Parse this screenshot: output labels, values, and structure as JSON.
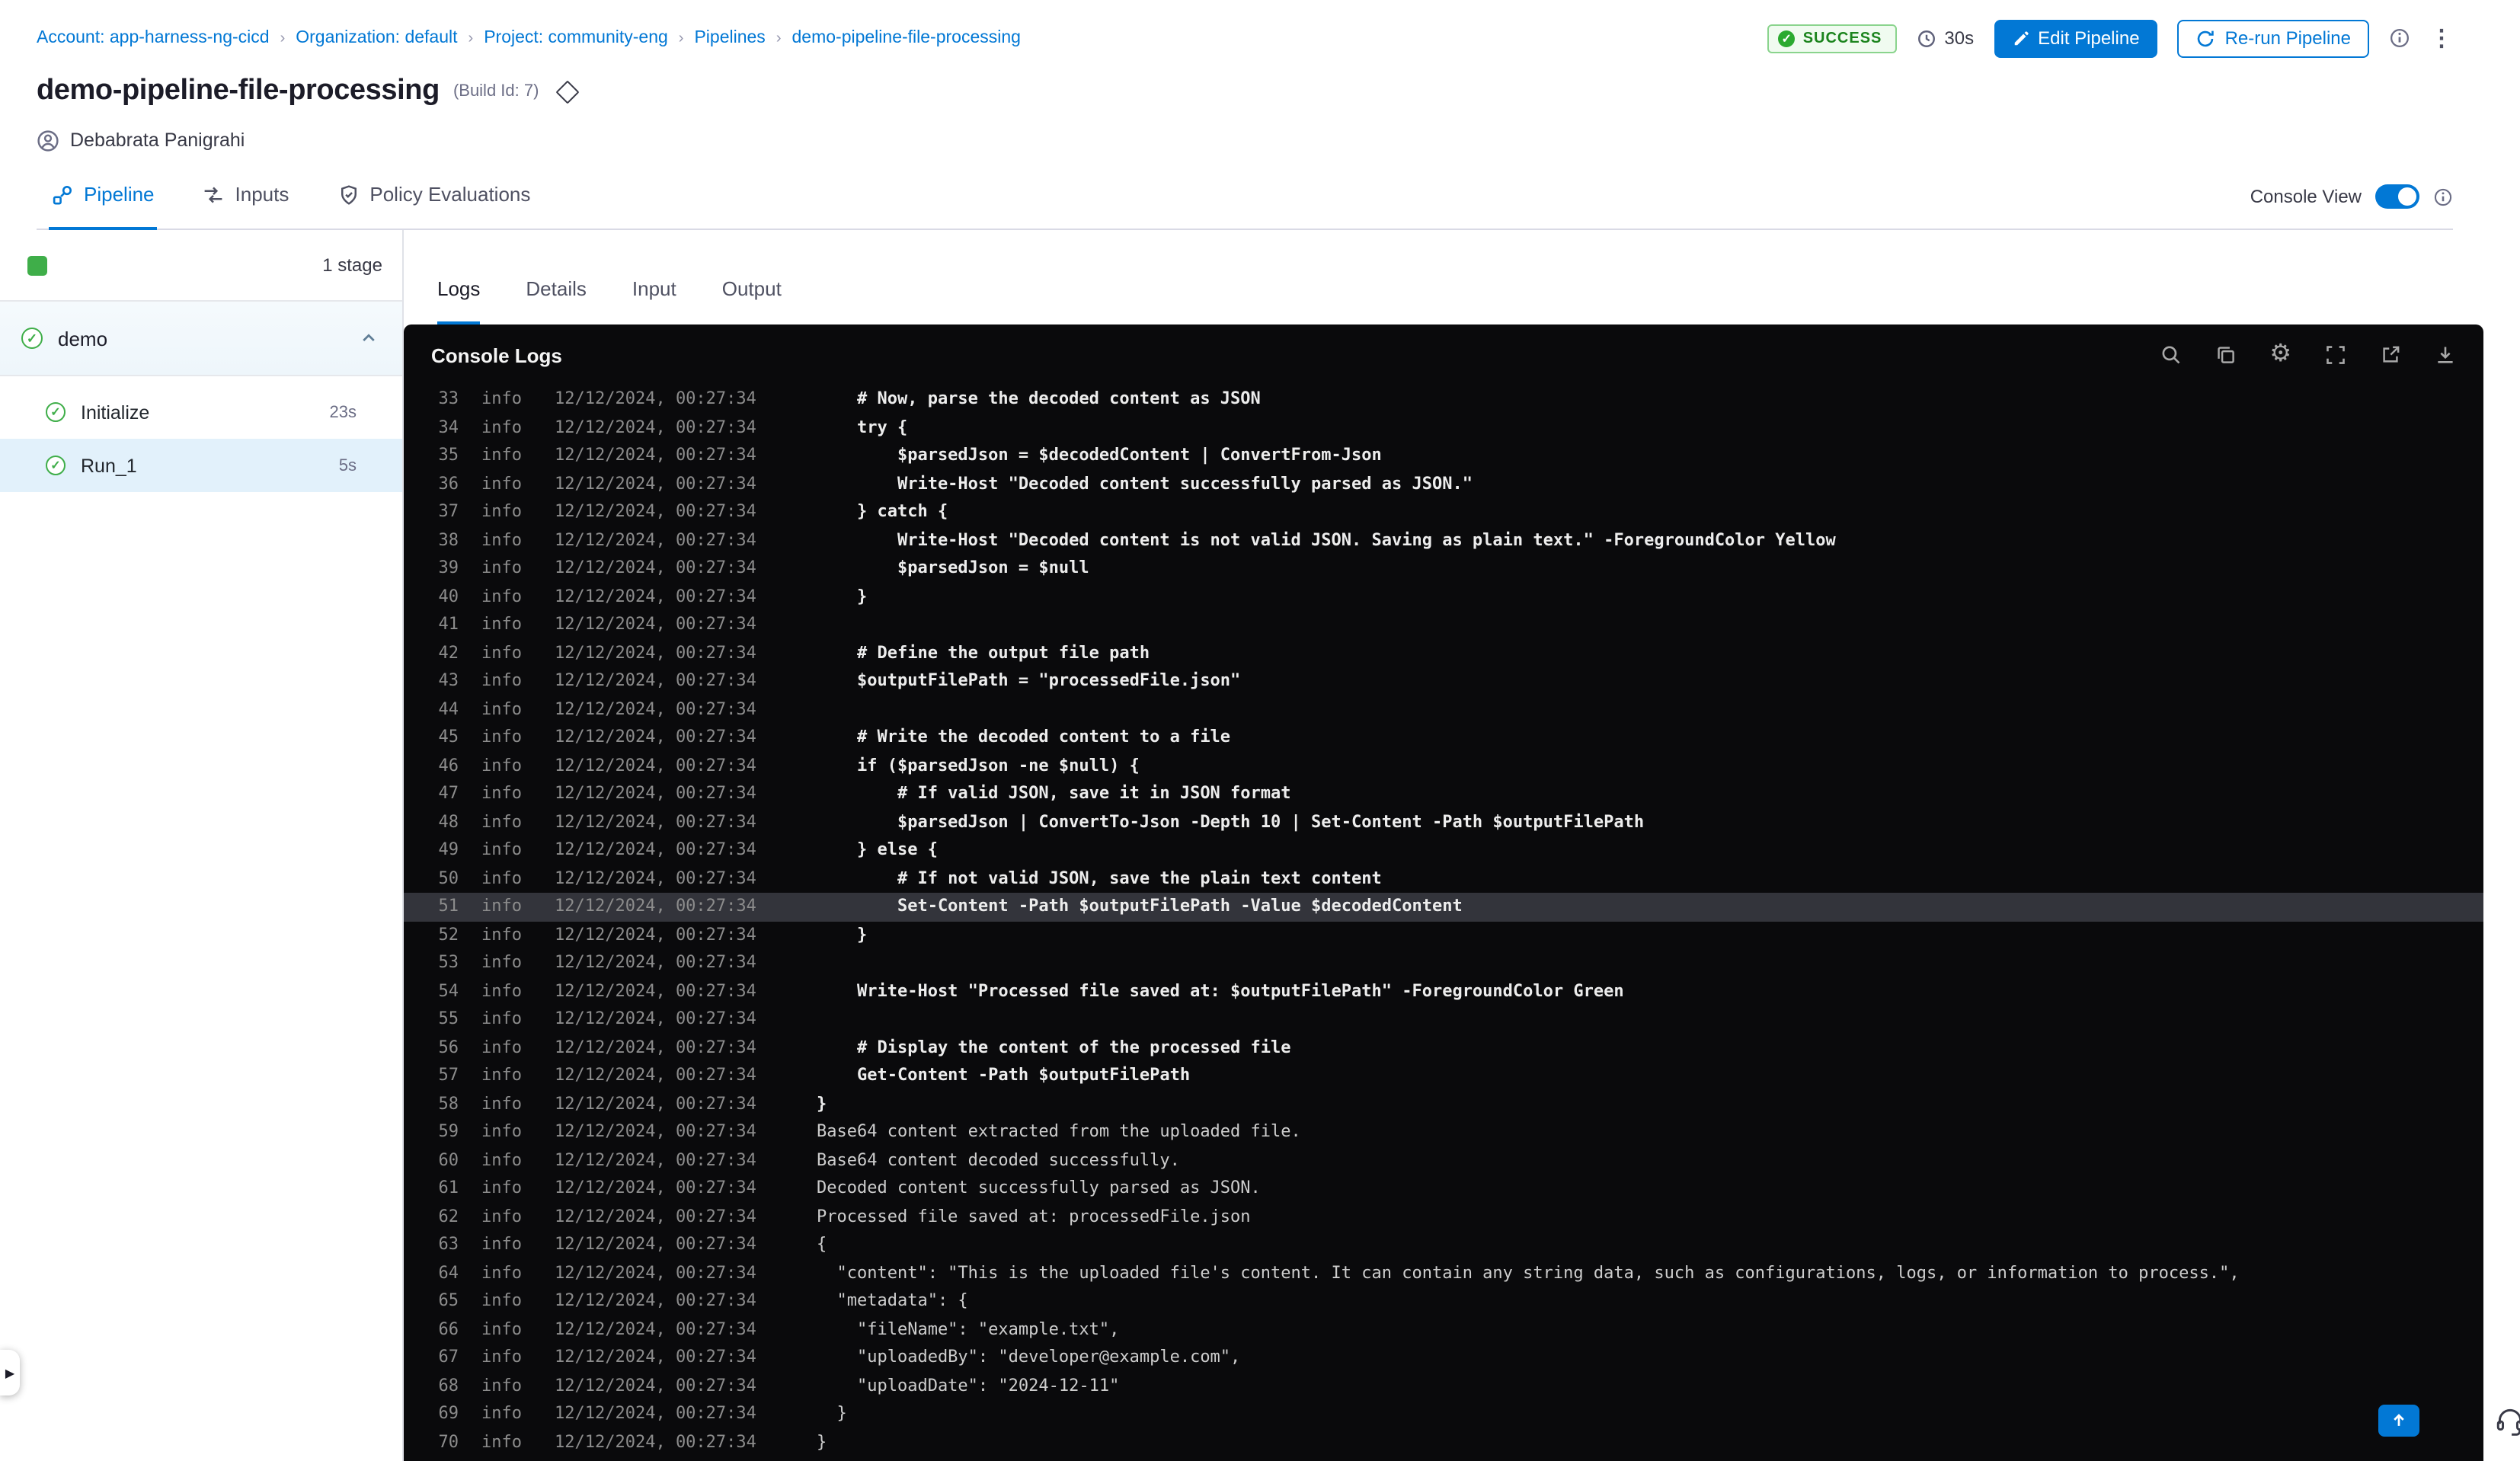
{
  "breadcrumb": {
    "items": [
      "Account: app-harness-ng-cicd",
      "Organization: default",
      "Project: community-eng",
      "Pipelines",
      "demo-pipeline-file-processing"
    ]
  },
  "header": {
    "status": "SUCCESS",
    "duration": "30s",
    "edit_pipeline": "Edit Pipeline",
    "rerun_pipeline": "Re-run Pipeline",
    "title": "demo-pipeline-file-processing",
    "build_id": "(Build Id: 7)",
    "user": "Debabrata Panigrahi"
  },
  "nav_tabs": [
    {
      "label": "Pipeline",
      "active": true
    },
    {
      "label": "Inputs",
      "active": false
    },
    {
      "label": "Policy Evaluations",
      "active": false
    }
  ],
  "console_view": {
    "label": "Console View",
    "enabled": true
  },
  "sidebar": {
    "stage_count": "1 stage",
    "stage_name": "demo",
    "steps": [
      {
        "name": "Initialize",
        "duration": "23s",
        "selected": false
      },
      {
        "name": "Run_1",
        "duration": "5s",
        "selected": true
      }
    ]
  },
  "log_tabs": [
    {
      "label": "Logs",
      "active": true
    },
    {
      "label": "Details",
      "active": false
    },
    {
      "label": "Input",
      "active": false
    },
    {
      "label": "Output",
      "active": false
    }
  ],
  "console": {
    "title": "Console Logs",
    "level": "info",
    "timestamp": "12/12/2024, 00:27:34",
    "colors": {
      "accent": "#0278D5",
      "success_green": "#3FAE49",
      "console_bg": "#0A0A0C",
      "highlight_row": "#33343B"
    },
    "scroll_top_label": "↑",
    "lines": [
      {
        "n": 33,
        "t": "    # Now, parse the decoded content as JSON",
        "b": true
      },
      {
        "n": 34,
        "t": "    try {",
        "b": true
      },
      {
        "n": 35,
        "t": "        $parsedJson = $decodedContent | ConvertFrom-Json",
        "b": true
      },
      {
        "n": 36,
        "t": "        Write-Host \"Decoded content successfully parsed as JSON.\"",
        "b": true
      },
      {
        "n": 37,
        "t": "    } catch {",
        "b": true
      },
      {
        "n": 38,
        "t": "        Write-Host \"Decoded content is not valid JSON. Saving as plain text.\" -ForegroundColor Yellow",
        "b": true
      },
      {
        "n": 39,
        "t": "        $parsedJson = $null",
        "b": true
      },
      {
        "n": 40,
        "t": "    }",
        "b": true
      },
      {
        "n": 41,
        "t": "",
        "b": true
      },
      {
        "n": 42,
        "t": "    # Define the output file path",
        "b": true
      },
      {
        "n": 43,
        "t": "    $outputFilePath = \"processedFile.json\"",
        "b": true
      },
      {
        "n": 44,
        "t": "",
        "b": true
      },
      {
        "n": 45,
        "t": "    # Write the decoded content to a file",
        "b": true
      },
      {
        "n": 46,
        "t": "    if ($parsedJson -ne $null) {",
        "b": true
      },
      {
        "n": 47,
        "t": "        # If valid JSON, save it in JSON format",
        "b": true
      },
      {
        "n": 48,
        "t": "        $parsedJson | ConvertTo-Json -Depth 10 | Set-Content -Path $outputFilePath",
        "b": true
      },
      {
        "n": 49,
        "t": "    } else {",
        "b": true
      },
      {
        "n": 50,
        "t": "        # If not valid JSON, save the plain text content",
        "b": true
      },
      {
        "n": 51,
        "t": "        Set-Content -Path $outputFilePath -Value $decodedContent",
        "b": true,
        "h": true
      },
      {
        "n": 52,
        "t": "    }",
        "b": true
      },
      {
        "n": 53,
        "t": "",
        "b": true
      },
      {
        "n": 54,
        "t": "    Write-Host \"Processed file saved at: $outputFilePath\" -ForegroundColor Green",
        "b": true
      },
      {
        "n": 55,
        "t": "",
        "b": true
      },
      {
        "n": 56,
        "t": "    # Display the content of the processed file",
        "b": true
      },
      {
        "n": 57,
        "t": "    Get-Content -Path $outputFilePath",
        "b": true
      },
      {
        "n": 58,
        "t": "}",
        "b": true
      },
      {
        "n": 59,
        "t": "Base64 content extracted from the uploaded file.",
        "b": false
      },
      {
        "n": 60,
        "t": "Base64 content decoded successfully.",
        "b": false
      },
      {
        "n": 61,
        "t": "Decoded content successfully parsed as JSON.",
        "b": false
      },
      {
        "n": 62,
        "t": "Processed file saved at: processedFile.json",
        "b": false
      },
      {
        "n": 63,
        "t": "{",
        "b": false
      },
      {
        "n": 64,
        "t": "  \"content\": \"This is the uploaded file's content. It can contain any string data, such as configurations, logs, or information to process.\",",
        "b": false
      },
      {
        "n": 65,
        "t": "  \"metadata\": {",
        "b": false
      },
      {
        "n": 66,
        "t": "    \"fileName\": \"example.txt\",",
        "b": false
      },
      {
        "n": 67,
        "t": "    \"uploadedBy\": \"developer@example.com\",",
        "b": false
      },
      {
        "n": 68,
        "t": "    \"uploadDate\": \"2024-12-11\"",
        "b": false
      },
      {
        "n": 69,
        "t": "  }",
        "b": false
      },
      {
        "n": 70,
        "t": "}",
        "b": false
      }
    ]
  }
}
